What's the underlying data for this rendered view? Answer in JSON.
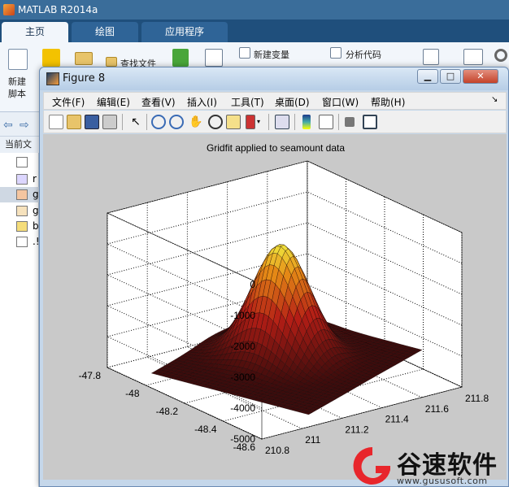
{
  "matlab": {
    "title": "MATLAB R2014a",
    "tabs": [
      "主页",
      "绘图",
      "应用程序"
    ],
    "toolstrip": {
      "new_script_line1": "新建",
      "new_script_line2": "脚本",
      "find_files": "查找文件",
      "new_variable": "新建变量",
      "analyze_code": "分析代码"
    },
    "current_folder": "当前文",
    "files": [
      {
        "name": "r"
      },
      {
        "name": "g"
      },
      {
        "name": "g"
      },
      {
        "name": "b"
      },
      {
        "name": ".!"
      }
    ]
  },
  "figure": {
    "title": "Figure 8",
    "menus": [
      "文件(F)",
      "编辑(E)",
      "查看(V)",
      "插入(I)",
      "工具(T)",
      "桌面(D)",
      "窗口(W)",
      "帮助(H)"
    ],
    "toolbar_icons": [
      "new-figure-icon",
      "open-icon",
      "save-icon",
      "print-icon",
      "pointer-icon",
      "zoom-in-icon",
      "zoom-out-icon",
      "pan-icon",
      "rotate-icon",
      "data-cursor-icon",
      "brush-icon",
      "link-icon",
      "colorbar-icon",
      "legend-icon",
      "hide-plot-tools-icon",
      "show-plot-tools-icon"
    ]
  },
  "chart_data": {
    "type": "surface",
    "title": "Gridfit applied to seamount data",
    "xlabel": "",
    "ylabel": "",
    "zlabel": "",
    "x_ticks": [
      "210.8",
      "211",
      "211.2",
      "211.4",
      "211.6",
      "211.8"
    ],
    "y_ticks": [
      "-47.8",
      "-48",
      "-48.2",
      "-48.4",
      "-48.6"
    ],
    "z_ticks": [
      "0",
      "-1000",
      "-2000",
      "-3000",
      "-4000",
      "-5000"
    ],
    "xlim": [
      210.8,
      211.8
    ],
    "ylim": [
      -48.6,
      -47.8
    ],
    "zlim": [
      -5000,
      0
    ],
    "grid": true,
    "peak_depth_approx": -1000,
    "floor_depth_approx": -4600,
    "colormap": "hot"
  },
  "watermark": {
    "text": "谷速软件",
    "url": "www.gususoft.com"
  }
}
